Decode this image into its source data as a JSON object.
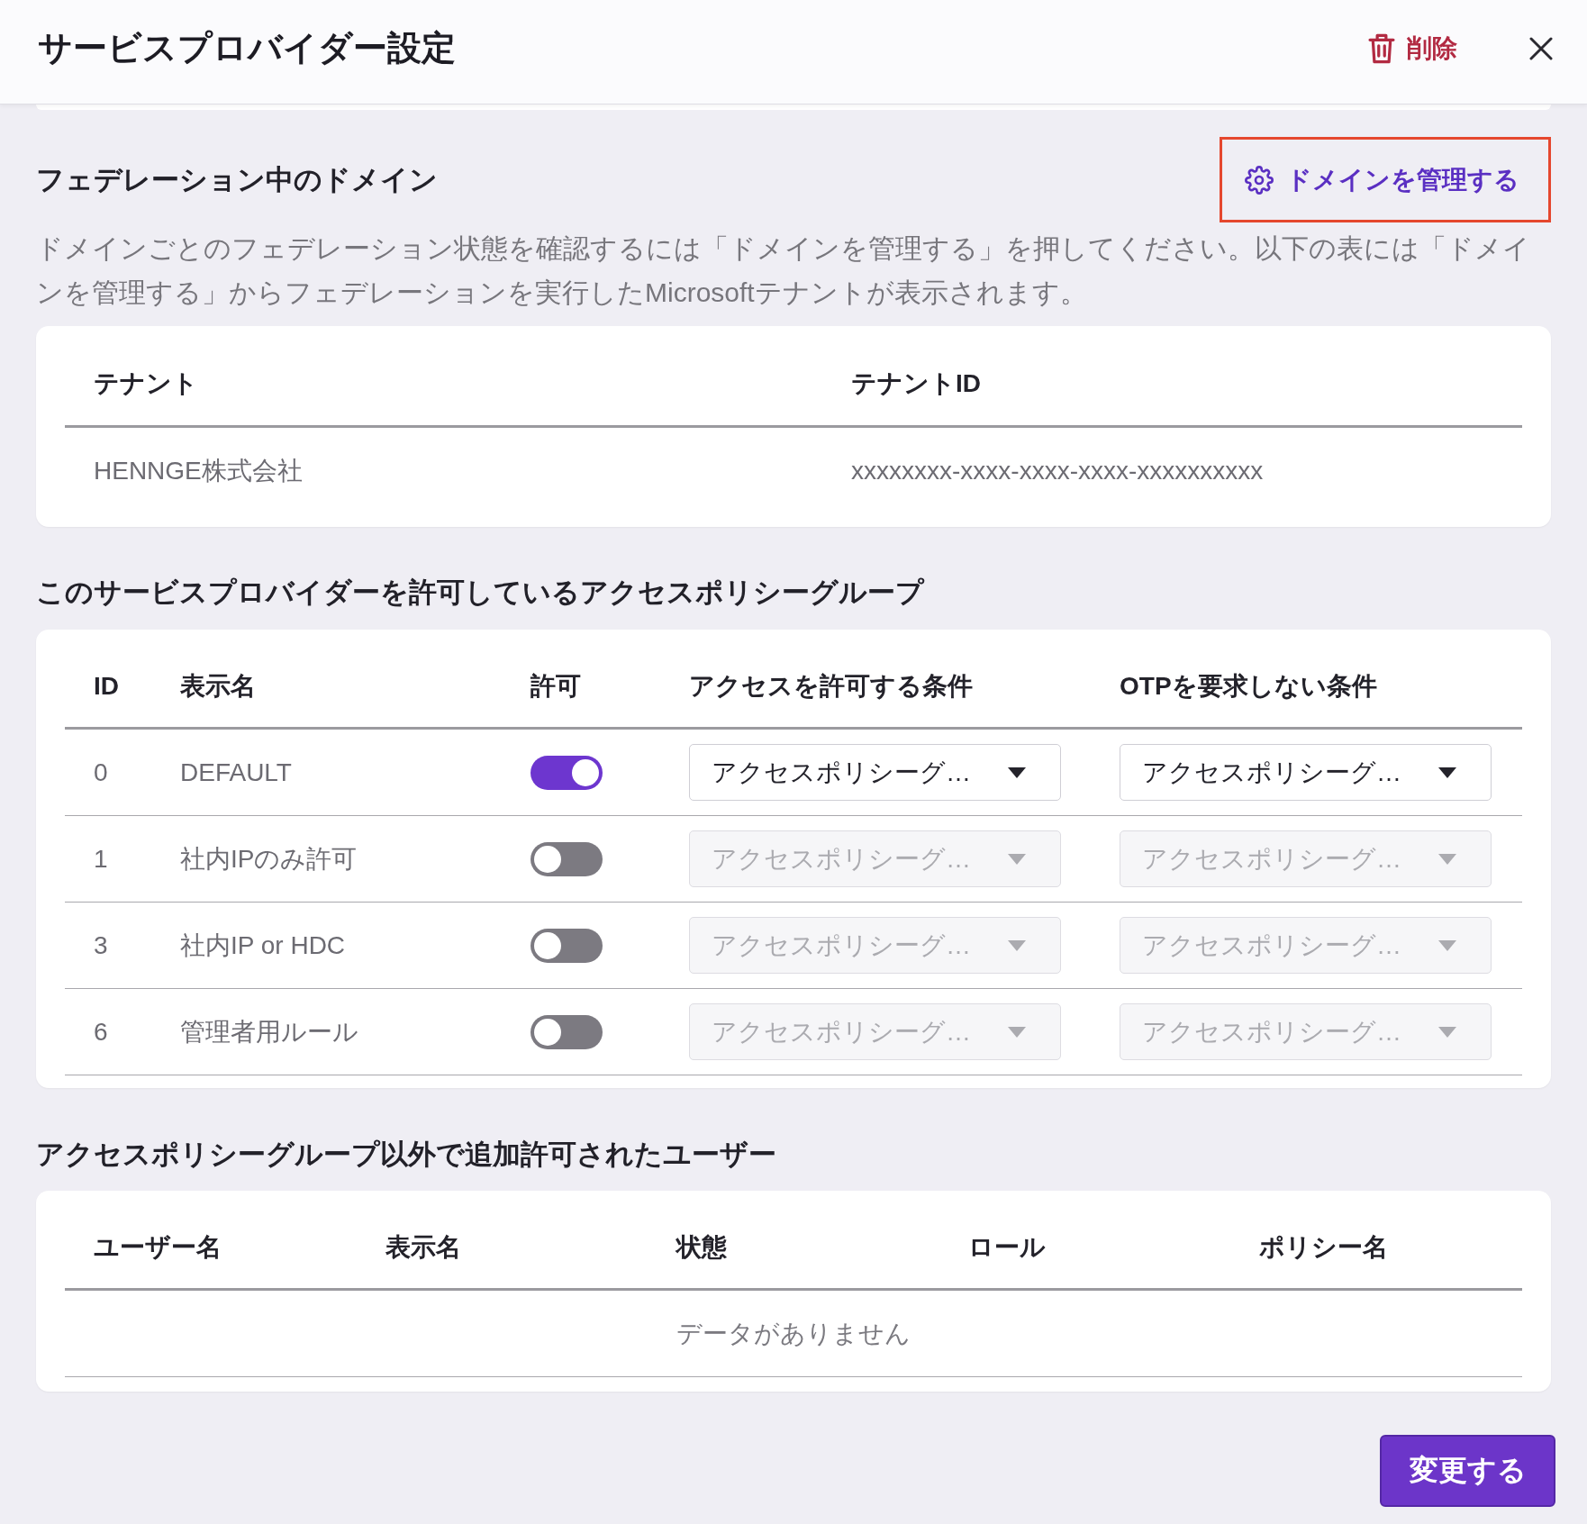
{
  "header": {
    "title": "サービスプロバイダー設定",
    "delete_button": {
      "label": "削除"
    }
  },
  "federated_domains": {
    "heading": "フェデレーション中のドメイン",
    "manage_button": {
      "label": "ドメインを管理する",
      "highlighted": true
    },
    "description": "ドメインごとのフェデレーション状態を確認するには「ドメインを管理する」を押してください。以下の表には「ドメインを管理する」からフェデレーションを実行したMicrosoftテナントが表示されます。",
    "table": {
      "columns": [
        "テナント",
        "テナントID"
      ],
      "rows": [
        [
          "HENNGE株式会社",
          "xxxxxxxx-xxxx-xxxx-xxxx-xxxxxxxxxx"
        ]
      ]
    }
  },
  "access_policy_groups": {
    "heading": "このサービスプロバイダーを許可しているアクセスポリシーグループ",
    "table": {
      "columns": [
        "ID",
        "表示名",
        "許可",
        "アクセスを許可する条件",
        "OTPを要求しない条件"
      ],
      "rows": [
        {
          "id": "0",
          "name": "DEFAULT",
          "allowed": true,
          "access_condition": {
            "value": "アクセスポリシーグ…",
            "disabled": false
          },
          "otp_condition": {
            "value": "アクセスポリシーグ…",
            "disabled": false
          }
        },
        {
          "id": "1",
          "name": "社内IPのみ許可",
          "allowed": false,
          "access_condition": {
            "value": "アクセスポリシーグ…",
            "disabled": true
          },
          "otp_condition": {
            "value": "アクセスポリシーグ…",
            "disabled": true
          }
        },
        {
          "id": "3",
          "name": "社内IP or HDC",
          "allowed": false,
          "access_condition": {
            "value": "アクセスポリシーグ…",
            "disabled": true
          },
          "otp_condition": {
            "value": "アクセスポリシーグ…",
            "disabled": true
          }
        },
        {
          "id": "6",
          "name": "管理者用ルール",
          "allowed": false,
          "access_condition": {
            "value": "アクセスポリシーグ…",
            "disabled": true
          },
          "otp_condition": {
            "value": "アクセスポリシーグ…",
            "disabled": true
          }
        }
      ]
    }
  },
  "additional_users": {
    "heading": "アクセスポリシーグループ以外で追加許可されたユーザー",
    "table": {
      "columns": [
        "ユーザー名",
        "表示名",
        "状態",
        "ロール",
        "ポリシー名"
      ],
      "empty_message": "データがありません"
    }
  },
  "footer": {
    "submit_button": {
      "label": "変更する"
    }
  }
}
